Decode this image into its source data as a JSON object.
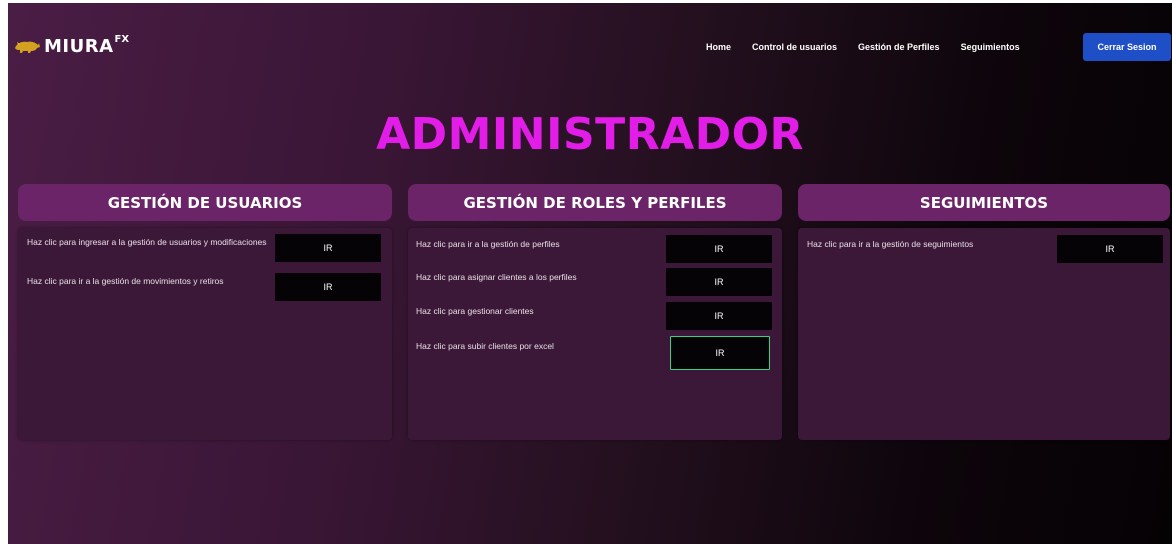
{
  "brand": {
    "name": "MIURA",
    "superscript": "FX"
  },
  "nav": {
    "links": [
      "Home",
      "Control de usuarios",
      "Gestión de Perfiles",
      "Seguimientos"
    ],
    "logout_label": "Cerrar Sesion"
  },
  "page_title": "ADMINISTRADOR",
  "panels": [
    {
      "title": "GESTIÓN DE USUARIOS",
      "rows": [
        {
          "text": "Haz clic para ingresar a la gestión de usuarios y modificaciones",
          "button": "IR"
        },
        {
          "text": "Haz clic para ir a la gestión de movimientos y retiros",
          "button": "IR"
        }
      ]
    },
    {
      "title": "GESTIÓN DE ROLES Y PERFILES",
      "rows": [
        {
          "text": "Haz clic para ir a la gestión de perfiles",
          "button": "IR"
        },
        {
          "text": "Haz clic para asignar clientes a los perfiles",
          "button": "IR"
        },
        {
          "text": "Haz clic para gestionar clientes",
          "button": "IR"
        },
        {
          "text": "Haz clic para subir clientes por excel",
          "button": "IR"
        }
      ]
    },
    {
      "title": "SEGUIMIENTOS",
      "rows": [
        {
          "text": "Haz clic para ir a la gestión de seguimientos",
          "button": "IR"
        }
      ]
    }
  ],
  "colors": {
    "title_accent": "#e31de8",
    "logout_button": "#1e4fc7",
    "panel_header": "#6b2468",
    "focus_outline": "#2fd48a"
  },
  "icons": {
    "logo": "bull-logo-icon"
  }
}
